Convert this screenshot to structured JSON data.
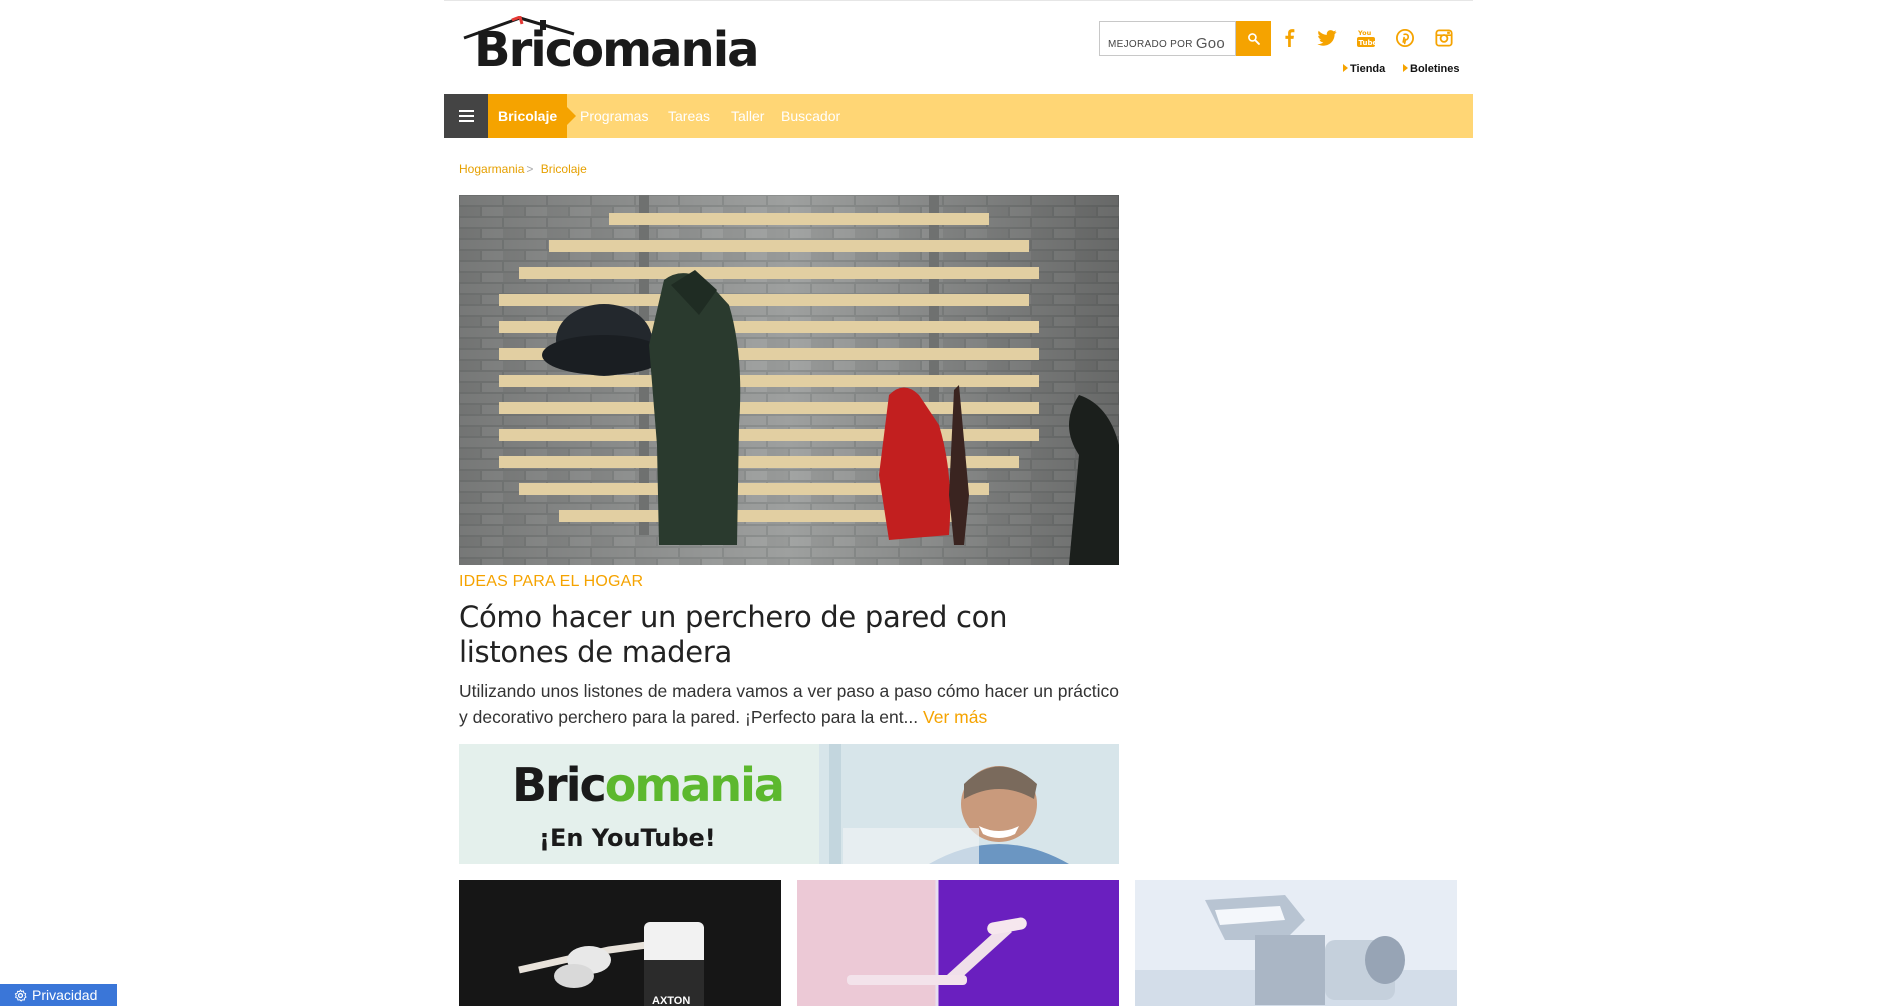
{
  "brand": {
    "logo_text": "Bricomania",
    "accent_color": "#f5a300",
    "nav_bg_color": "#ffd675"
  },
  "header": {
    "search": {
      "powered_label": "MEJORADO POR",
      "powered_brand": "Goo",
      "button_icon": "search-icon"
    },
    "social": [
      {
        "name": "facebook-icon"
      },
      {
        "name": "twitter-icon"
      },
      {
        "name": "youtube-icon"
      },
      {
        "name": "pinterest-icon"
      },
      {
        "name": "instagram-icon"
      }
    ],
    "links": [
      {
        "label": "Tienda"
      },
      {
        "label": "Boletines"
      }
    ]
  },
  "nav": {
    "menu_icon": "menu-icon",
    "active": "Bricolaje",
    "items": [
      {
        "label": "Programas"
      },
      {
        "label": "Tareas"
      },
      {
        "label": "Taller"
      },
      {
        "label": "Buscador"
      }
    ]
  },
  "breadcrumb": {
    "items": [
      {
        "label": "Hogarmania"
      },
      {
        "label": "Bricolaje"
      }
    ],
    "separator": ">"
  },
  "featured": {
    "category": "IDEAS PARA EL HOGAR",
    "title": "Cómo hacer un perchero de pared con listones de madera",
    "excerpt": "Utilizando unos listones de madera vamos a ver paso a paso cómo hacer un práctico y decorativo perchero para la pared. ¡Perfecto para la ent...",
    "more_label": "Ver más"
  },
  "banner": {
    "logo_dark": "Bric",
    "logo_green": "omania",
    "subtitle": "¡En YouTube!"
  },
  "cards": [
    {
      "image_text": "AXTON"
    },
    {
      "image_text": ""
    },
    {
      "image_text": ""
    }
  ],
  "privacy": {
    "label": "Privacidad"
  }
}
